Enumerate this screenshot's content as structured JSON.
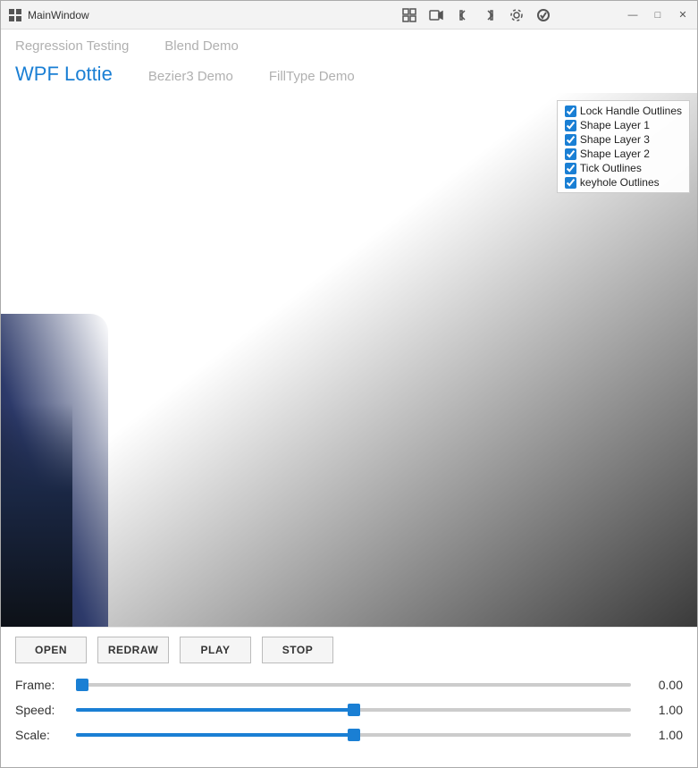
{
  "window": {
    "title": "MainWindow",
    "icon": "■"
  },
  "toolbar": {
    "buttons": [
      {
        "name": "grid-icon",
        "symbol": "⊞"
      },
      {
        "name": "video-icon",
        "symbol": "▶"
      },
      {
        "name": "back-icon",
        "symbol": "◁"
      },
      {
        "name": "forward-icon",
        "symbol": "▷"
      },
      {
        "name": "settings-icon",
        "symbol": "⚙"
      },
      {
        "name": "check-icon",
        "symbol": "✓"
      }
    ]
  },
  "titlebar_controls": {
    "minimize": "—",
    "maximize": "□",
    "close": "✕"
  },
  "nav": {
    "row1": [
      {
        "label": "Regression Testing",
        "active": false
      },
      {
        "label": "Blend Demo",
        "active": false
      }
    ],
    "row2": [
      {
        "label": "WPF Lottie",
        "active": true
      },
      {
        "label": "Bezier3 Demo",
        "active": false
      },
      {
        "label": "FillType Demo",
        "active": false
      }
    ]
  },
  "checkboxes": [
    {
      "id": "cb1",
      "label": "Lock Handle Outlines",
      "checked": true
    },
    {
      "id": "cb2",
      "label": "Shape Layer 1",
      "checked": true
    },
    {
      "id": "cb3",
      "label": "Shape Layer 3",
      "checked": true
    },
    {
      "id": "cb4",
      "label": "Shape Layer 2",
      "checked": true
    },
    {
      "id": "cb5",
      "label": "Tick Outlines",
      "checked": true
    },
    {
      "id": "cb6",
      "label": "keyhole Outlines",
      "checked": true
    }
  ],
  "buttons": {
    "open": "OPEN",
    "redraw": "REDRAW",
    "play": "PLAY",
    "stop": "STOP"
  },
  "sliders": {
    "frame": {
      "label": "Frame:",
      "value": 0.0,
      "display": "0.00",
      "min": 0,
      "max": 100,
      "percent": 0
    },
    "speed": {
      "label": "Speed:",
      "value": 1.0,
      "display": "1.00",
      "min": 0,
      "max": 2,
      "percent": 50
    },
    "scale": {
      "label": "Scale:",
      "value": 1.0,
      "display": "1.00",
      "min": 0,
      "max": 2,
      "percent": 52
    }
  },
  "colors": {
    "accent": "#1a7fd4",
    "active_nav": "#1a7fd4",
    "inactive_nav": "#b0b0b0"
  }
}
